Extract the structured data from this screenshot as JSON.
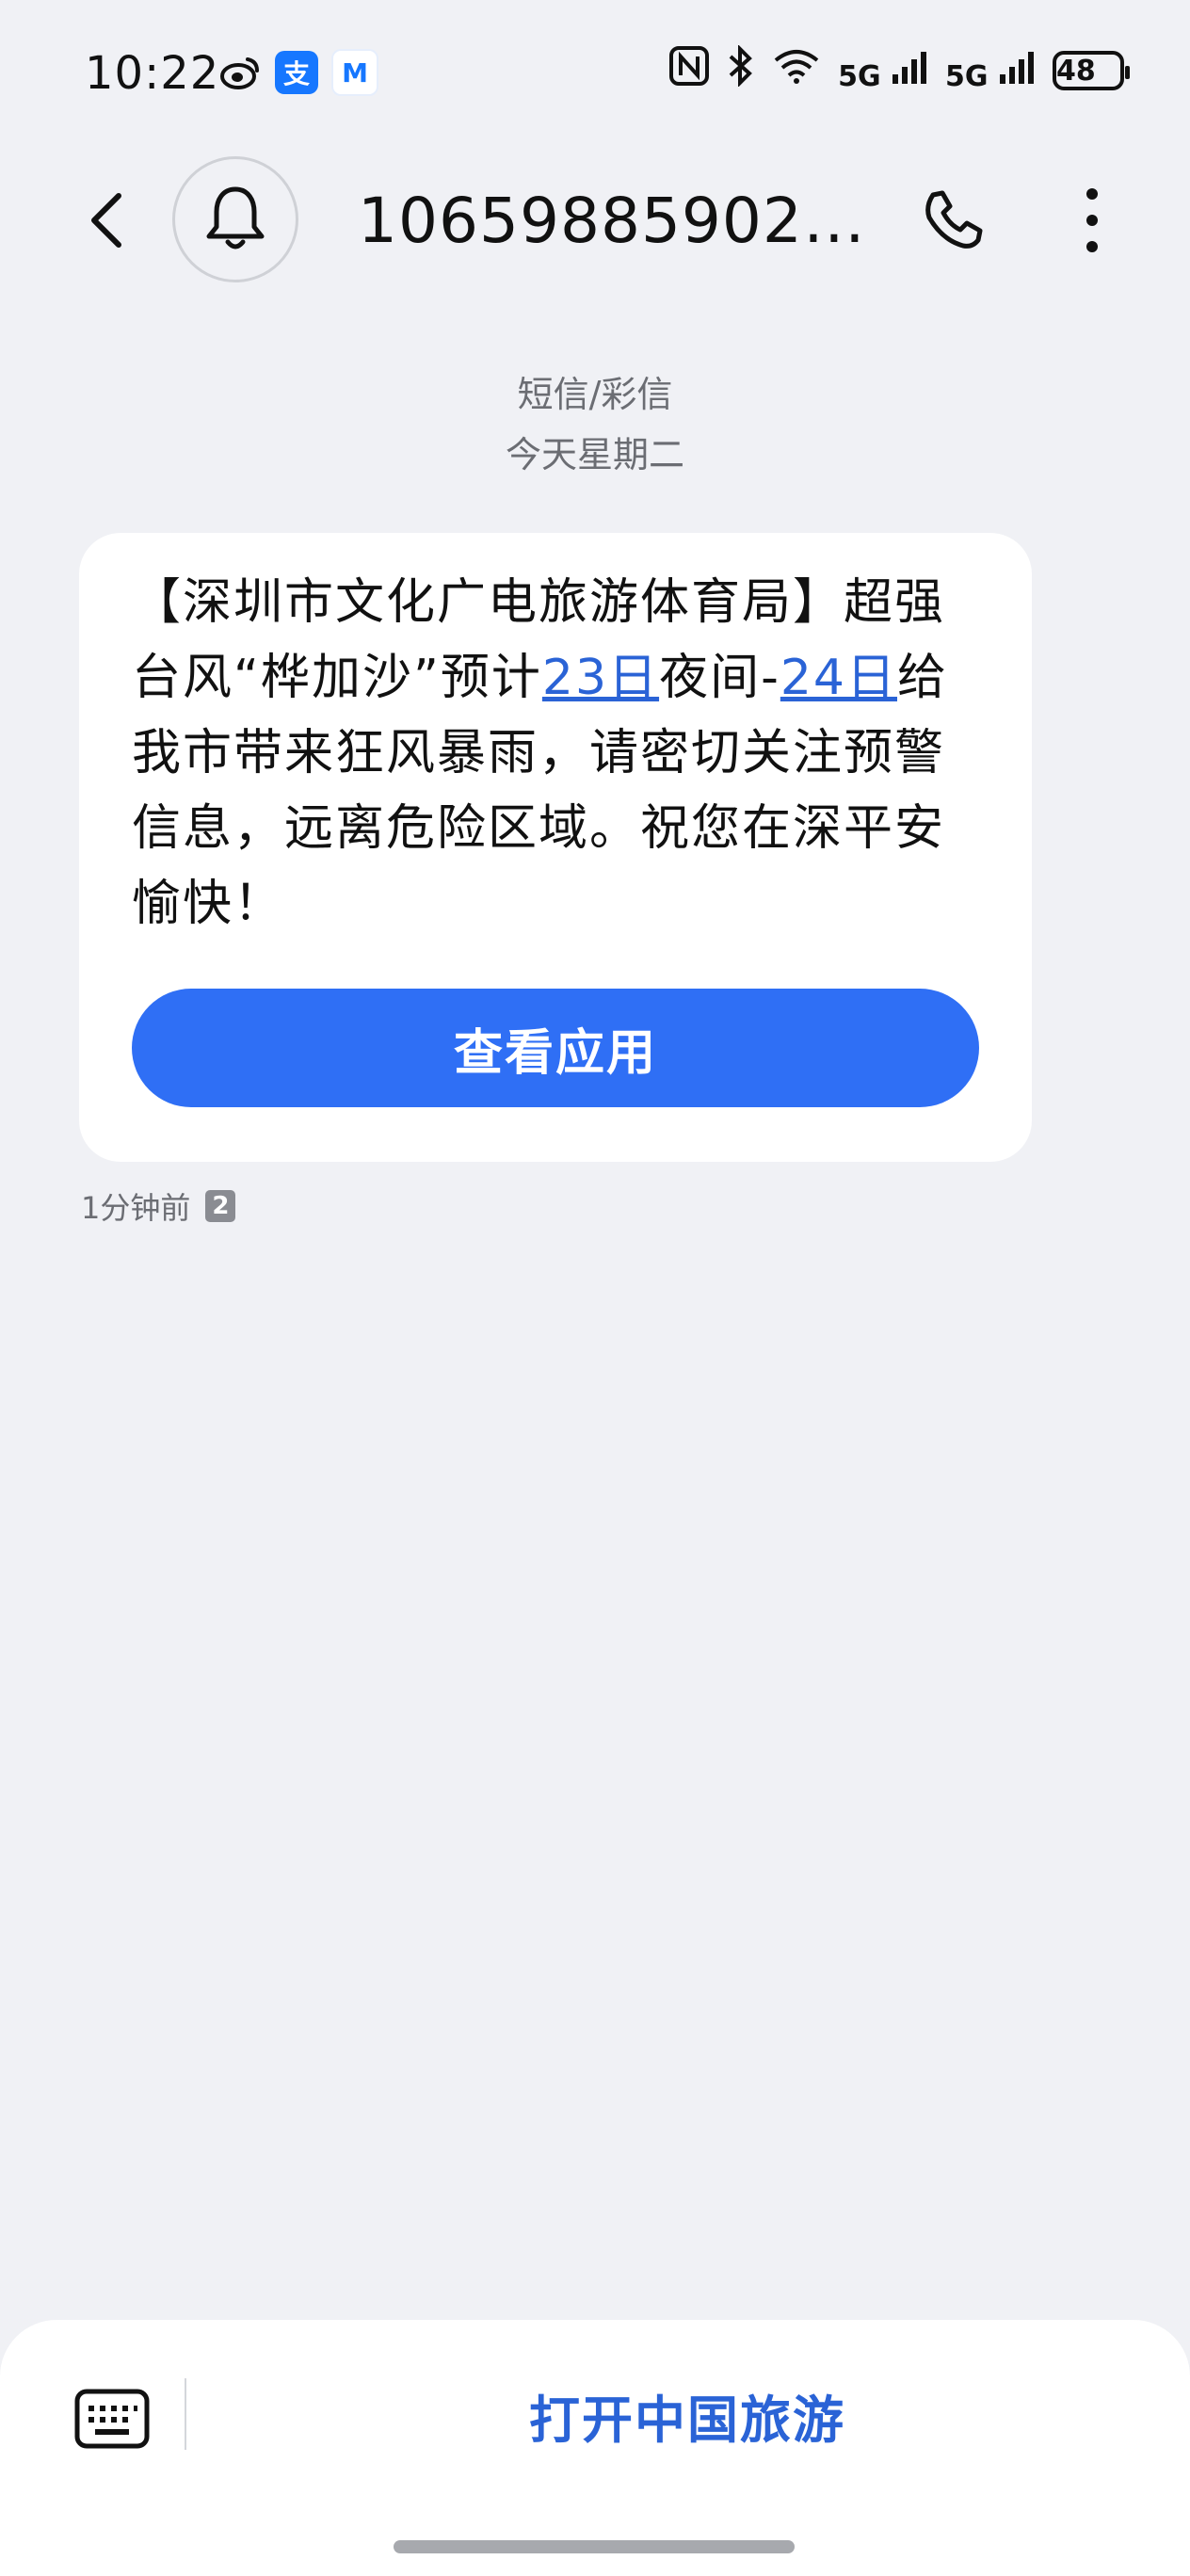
{
  "status_bar": {
    "time": "10:22",
    "app_icons": [
      "weibo-icon",
      "alipay-icon",
      "metro-icon"
    ],
    "alipay_glyph": "支",
    "metro_glyph": "M",
    "signal_label_1": "5G",
    "signal_label_2": "5G",
    "battery": "48"
  },
  "header": {
    "contact": "106598859020..."
  },
  "conversation": {
    "type_label": "短信/彩信",
    "date_label": "今天星期二"
  },
  "message": {
    "text_part1": "【深圳市文化广电旅游体育局】超强台风“桦加沙”预计",
    "link1": "23日",
    "text_part2": "夜间-",
    "link2": "24日",
    "text_part3": "给我市带来狂风暴雨，请密切关注预警信息，远离危险区域。祝您在深平安愉快！",
    "action_label": "查看应用",
    "time_ago": "1分钟前",
    "sim_slot": "2"
  },
  "bottom_bar": {
    "open_label": "打开中国旅游"
  },
  "colors": {
    "background": "#f0f1f5",
    "accent_blue": "#2f6ff5",
    "link_blue": "#2a63d6"
  }
}
